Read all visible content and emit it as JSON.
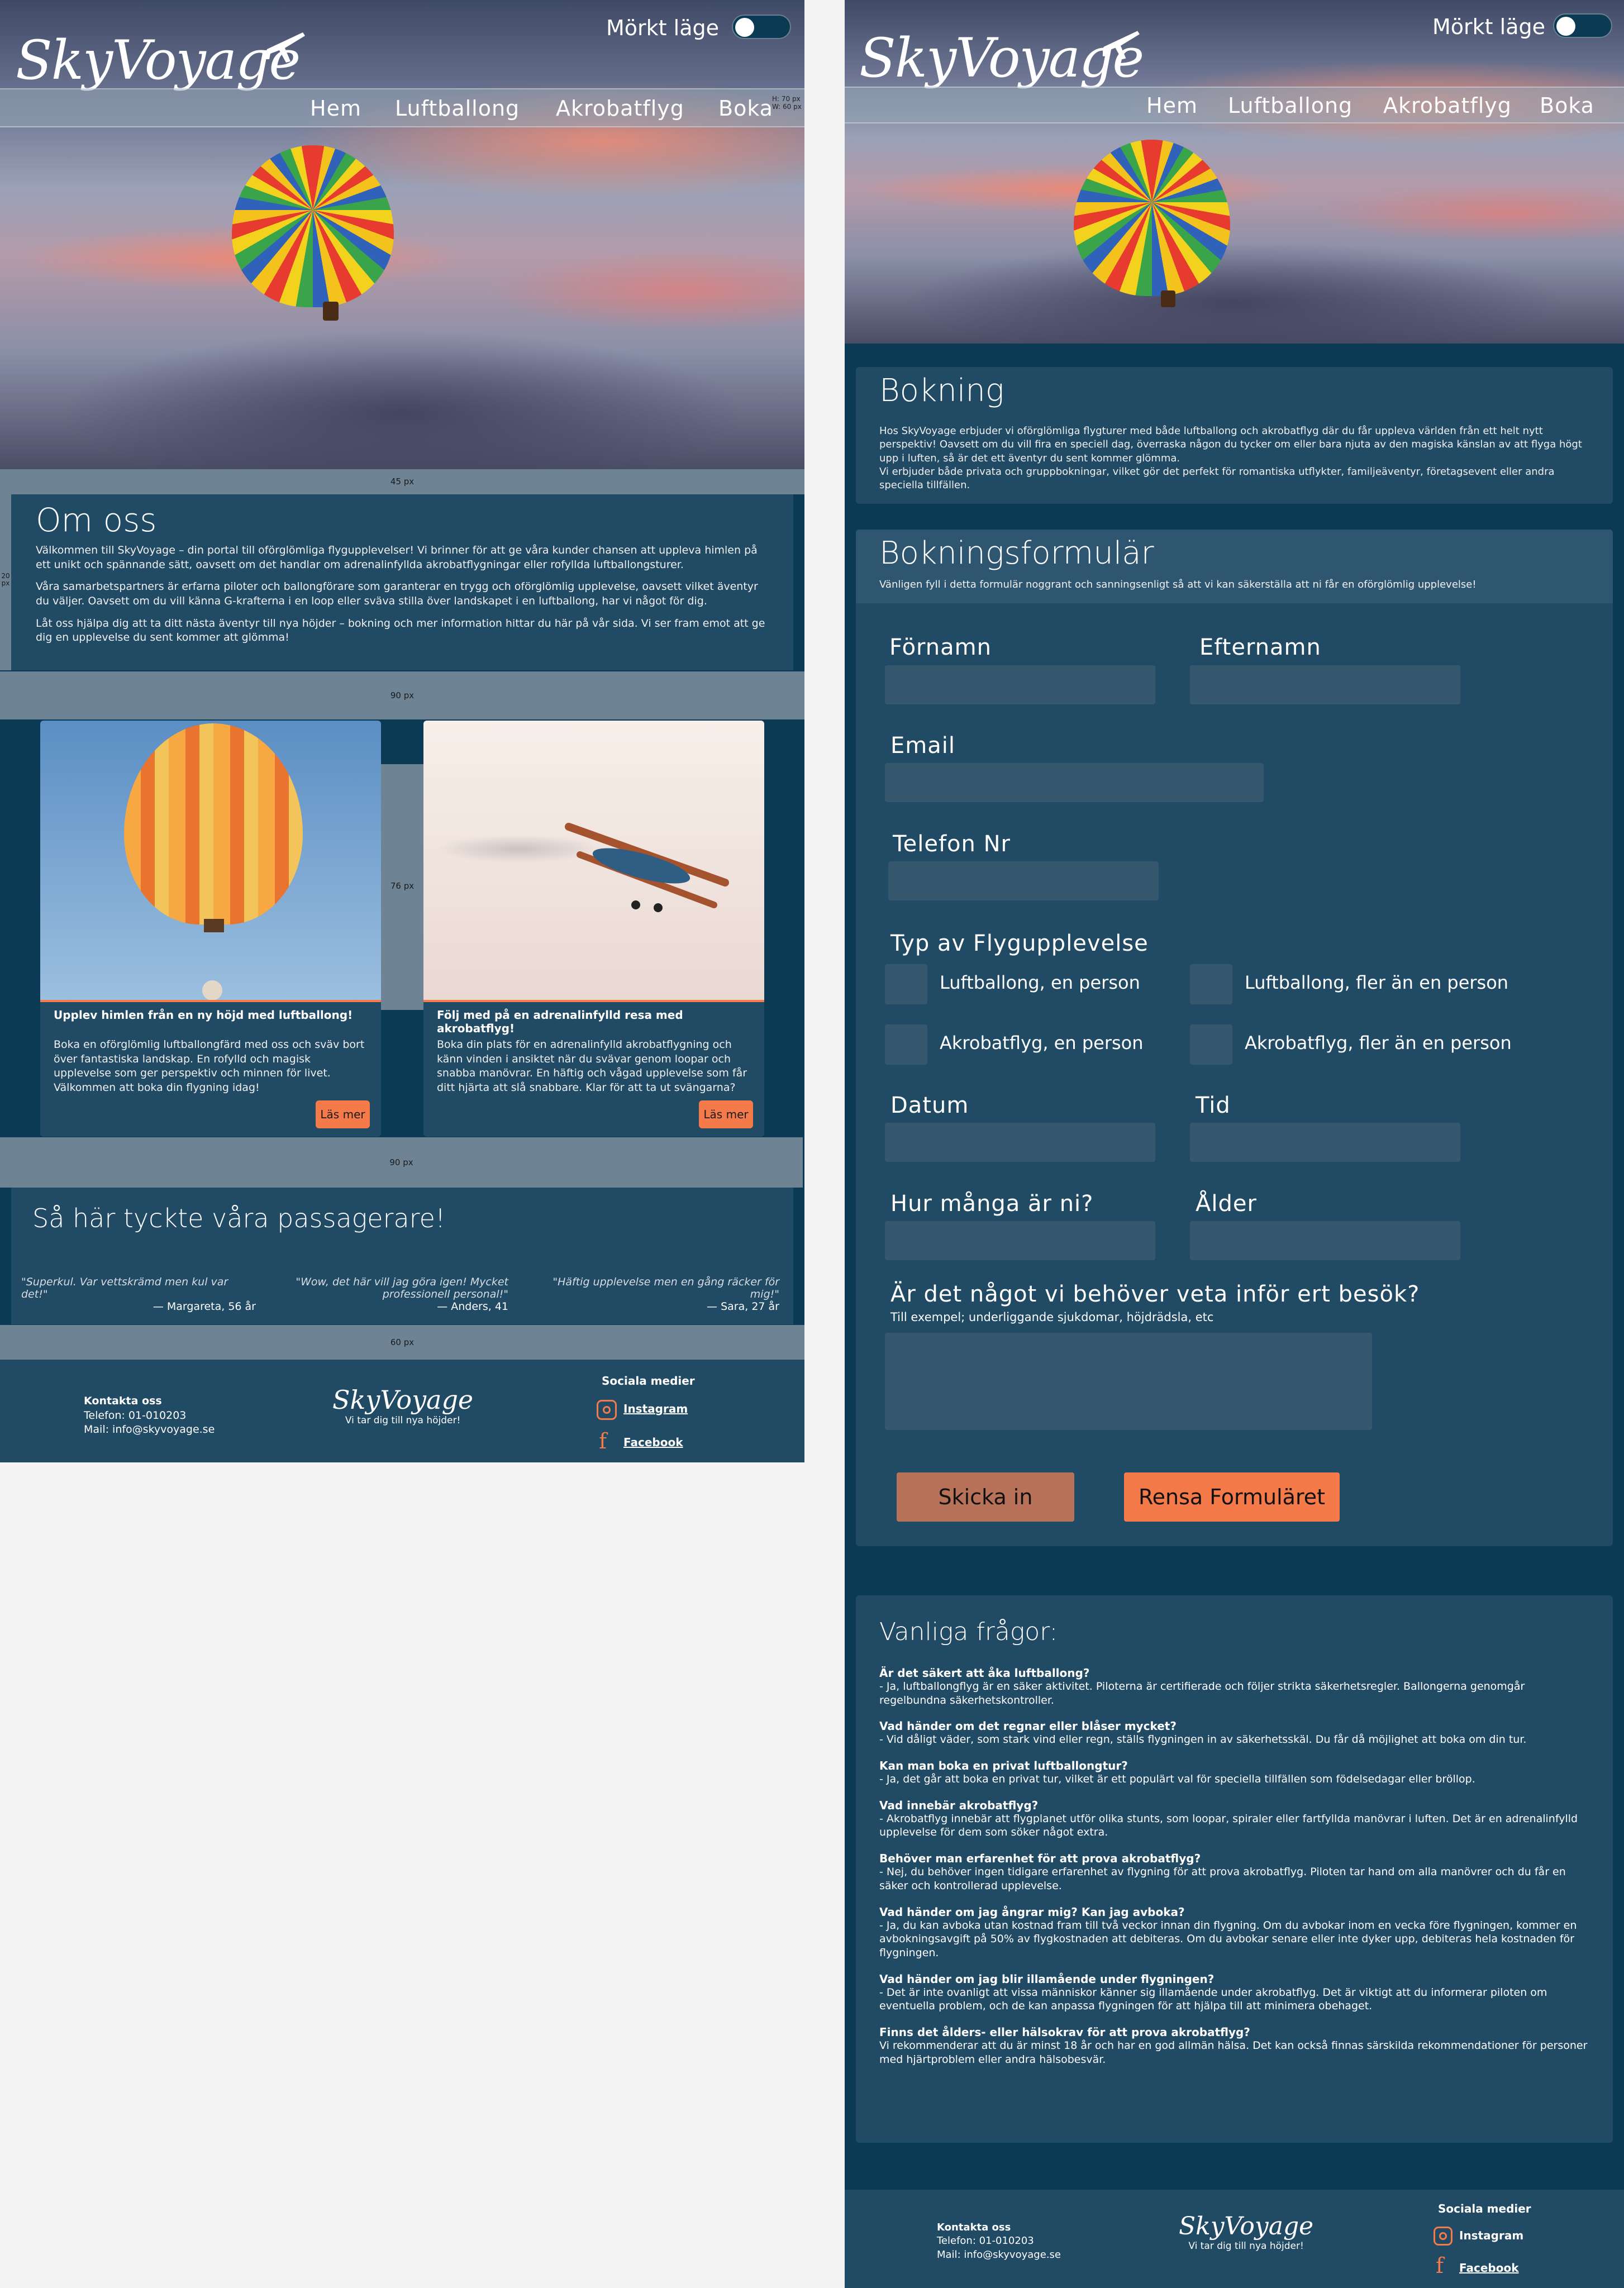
{
  "brand": {
    "logo": "SkyVoyage",
    "tagline": "Vi tar dig till nya höjder!"
  },
  "mode_toggle": {
    "label": "Mörkt läge"
  },
  "nav": [
    "Hem",
    "Luftballong",
    "Akrobatflyg",
    "Boka"
  ],
  "annotations": {
    "nav_hw": "H: 70 px\nW: 60 px",
    "gap45": "45 px",
    "gap20": "20 px",
    "gap90a": "90 px",
    "gap76": "76 px",
    "gap90b": "90 px",
    "gap60": "60 px"
  },
  "about": {
    "title": "Om oss",
    "p1": "Välkommen till SkyVoyage – din portal till oförglömliga flygupplevelser! Vi brinner för att ge våra kunder chansen att uppleva himlen på ett unikt och spännande sätt, oavsett om det handlar om adrenalinfyllda akrobatflygningar eller rofyllda luftballongsturer.",
    "p2": "Våra samarbetspartners är erfarna piloter och ballongförare som garanterar en trygg och oförglömlig upplevelse, oavsett vilket äventyr du väljer. Oavsett om du vill känna G-krafterna i en loop eller sväva stilla över landskapet i en luftballong, har vi något för dig.",
    "p3": "Låt oss hjälpa dig att ta ditt nästa äventyr till nya höjder – bokning och mer information hittar du här på vår sida. Vi ser fram emot att ge dig en upplevelse du sent kommer att glömma!"
  },
  "cards": [
    {
      "title": "Upplev himlen från en ny höjd med luftballong!",
      "text": "Boka en oförglömlig luftballongfärd med oss och sväv bort över fantastiska landskap. En rofylld och magisk upplevelse som ger perspektiv och minnen för livet. Välkommen att boka din flygning idag!",
      "button": "Läs mer"
    },
    {
      "title": "Följ med på en adrenalinfylld resa med akrobatflyg!",
      "text": "Boka din plats för en adrenalinfylld akrobatflygning och känn vinden i ansiktet när du svävar genom loopar och snabba manövrar. En häftig och vågad upplevelse som får ditt hjärta att slå snabbare. Klar för att ta ut svängarna?",
      "button": "Läs mer"
    }
  ],
  "reviews": {
    "title": "Så här tyckte våra passagerare!",
    "items": [
      {
        "quote": "\"Superkul. Var vettskrämd men kul var det!\"",
        "author": "— Margareta, 56 år"
      },
      {
        "quote": "\"Wow, det här vill jag göra igen! Mycket professionell personal!\"",
        "author": "— Anders, 41"
      },
      {
        "quote": "\"Häftig upplevelse men en gång räcker för mig!\"",
        "author": "— Sara, 27 år"
      }
    ]
  },
  "footer": {
    "contact_title": "Kontakta oss",
    "phone": "Telefon: 01-010203",
    "mail": "Mail: info@skyvoyage.se",
    "social_title": "Sociala medier",
    "instagram": "Instagram",
    "facebook": "Facebook"
  },
  "booking": {
    "title": "Bokning",
    "p1": "Hos SkyVoyage erbjuder vi oförglömliga flygturer med både luftballong och akrobatflyg där du får uppleva världen från ett helt nytt perspektiv! Oavsett om du vill fira en speciell dag, överraska någon du tycker om eller bara njuta av den magiska känslan av att flyga högt upp i luften, så är det ett äventyr du sent kommer glömma.",
    "p2": "Vi erbjuder både privata och gruppbokningar, vilket gör det perfekt för romantiska utflykter, familjeäventyr, företagsevent eller andra speciella tillfällen."
  },
  "form": {
    "title": "Bokningsformulär",
    "subtitle": "Vänligen fyll i detta formulär noggrant och sanningsenligt så att vi kan säkerställa att ni får en oförglömlig upplevelse!",
    "firstname": "Förnamn",
    "lastname": "Efternamn",
    "email": "Email",
    "phone": "Telefon Nr",
    "type_title": "Typ av Flygupplevelse",
    "options": [
      "Luftballong, en person",
      "Luftballong, fler än en person",
      "Akrobatflyg, en person",
      "Akrobatflyg, fler än en person"
    ],
    "date": "Datum",
    "time": "Tid",
    "count": "Hur många är ni?",
    "age": "Ålder",
    "notes_title": "Är det något vi behöver veta inför ert besök?",
    "notes_hint": "Till exempel; underliggande sjukdomar, höjdrädsla, etc",
    "submit": "Skicka in",
    "reset": "Rensa Formuläret"
  },
  "faq": {
    "title": "Vanliga frågor:",
    "items": [
      {
        "q": "Är det säkert att åka luftballong?",
        "a": "- Ja, luftballongflyg är en säker aktivitet. Piloterna är certifierade och följer strikta säkerhetsregler. Ballongerna genomgår regelbundna säkerhetskontroller."
      },
      {
        "q": "Vad händer om det regnar eller blåser mycket?",
        "a": "- Vid dåligt väder, som stark vind eller regn, ställs flygningen in av säkerhetsskäl. Du får då möjlighet att boka om din tur."
      },
      {
        "q": "Kan man boka en privat luftballongtur?",
        "a": "- Ja, det går att boka en privat tur, vilket är ett populärt val för speciella tillfällen som födelsedagar eller bröllop."
      },
      {
        "q": "Vad innebär akrobatflyg?",
        "a": "- Akrobatflyg innebär att flygplanet utför olika stunts, som loopar, spiraler eller fartfyllda manövrar i luften. Det är en adrenalinfylld upplevelse för dem som söker något extra."
      },
      {
        "q": "Behöver man erfarenhet för att prova akrobatflyg?",
        "a": "- Nej, du behöver ingen tidigare erfarenhet av flygning för att prova akrobatflyg. Piloten tar hand om alla manövrer och du får en säker och kontrollerad upplevelse."
      },
      {
        "q": "Vad händer om jag ångrar mig? Kan jag avboka?",
        "a": "- Ja, du kan avboka utan kostnad fram till två veckor innan din flygning. Om du avbokar inom en vecka före flygningen, kommer en avbokningsavgift på 50% av flygkostnaden att debiteras. Om du avbokar senare eller inte dyker upp, debiteras hela kostnaden för flygningen."
      },
      {
        "q": "Vad händer om jag blir illamående under flygningen?",
        "a": "- Det är inte ovanligt att vissa människor känner sig illamående under akrobatflyg. Det är viktigt att du informerar piloten om eventuella problem, och de kan anpassa flygningen för att hjälpa till att minimera obehaget."
      },
      {
        "q": "Finns det ålders- eller hälsokrav för att prova akrobatflyg?",
        "a": "Vi rekommenderar att du är minst 18 år och har en god allmän hälsa. Det kan också finnas särskilda rekommendationer för personer med hjärtproblem eller andra hälsobesvär."
      }
    ]
  },
  "colors": {
    "bg": "#0b3a55",
    "panel": "#214a64",
    "accent": "#f47a4a"
  }
}
